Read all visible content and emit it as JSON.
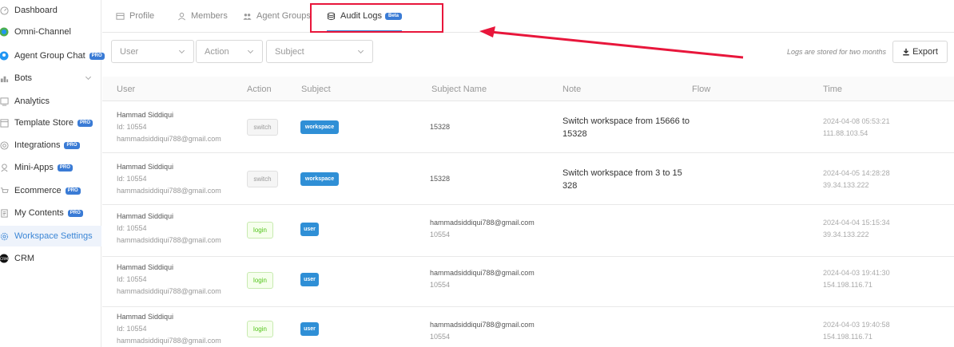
{
  "sidebar": {
    "items": [
      {
        "label": "Dashboard",
        "icon": "dashboard-icon",
        "pro": false
      },
      {
        "label": "Omni-Channel",
        "icon": "omni-channel-icon",
        "pro": false
      },
      {
        "label": "Agent Group Chat",
        "icon": "agent-chat-icon",
        "pro": true
      },
      {
        "label": "Bots",
        "icon": "bots-icon",
        "pro": false,
        "expandable": true
      },
      {
        "label": "Analytics",
        "icon": "analytics-icon",
        "pro": false
      },
      {
        "label": "Template Store",
        "icon": "template-store-icon",
        "pro": true
      },
      {
        "label": "Integrations",
        "icon": "integrations-icon",
        "pro": true
      },
      {
        "label": "Mini-Apps",
        "icon": "mini-apps-icon",
        "pro": true
      },
      {
        "label": "Ecommerce",
        "icon": "ecommerce-icon",
        "pro": true
      },
      {
        "label": "My Contents",
        "icon": "my-contents-icon",
        "pro": true
      },
      {
        "label": "Workspace Settings",
        "icon": "gear-icon",
        "pro": false,
        "active": true
      },
      {
        "label": "CRM",
        "icon": "crm-icon",
        "pro": false
      }
    ],
    "pro_label": "PRO"
  },
  "tabs": [
    {
      "label": "Profile",
      "icon": "profile-icon"
    },
    {
      "label": "Members",
      "icon": "members-icon"
    },
    {
      "label": "Agent Groups",
      "icon": "agent-groups-icon"
    },
    {
      "label": "Audit Logs",
      "icon": "database-icon",
      "active": true,
      "badge": "Beta"
    }
  ],
  "filters": {
    "user": "User",
    "action": "Action",
    "subject": "Subject"
  },
  "retention_note": "Logs are stored for two months",
  "export_label": "Export",
  "columns": [
    "User",
    "Action",
    "Subject",
    "Subject Name",
    "Note",
    "Flow",
    "Time"
  ],
  "rows": [
    {
      "name": "Hammad Siddiqui",
      "id": "Id: 10554",
      "email": "hammadsiddiqui788@gmail.com",
      "action": "switch",
      "subject": "workspace",
      "subject_name_1": "15328",
      "subject_name_2": "",
      "note": "Switch workspace from 15666 to 15328",
      "time": "2024-04-08 05:53:21",
      "ip": "111.88.103.54"
    },
    {
      "name": "Hammad Siddiqui",
      "id": "Id: 10554",
      "email": "hammadsiddiqui788@gmail.com",
      "action": "switch",
      "subject": "workspace",
      "subject_name_1": "15328",
      "subject_name_2": "",
      "note": "Switch workspace from 3 to 15328",
      "time": "2024-04-05 14:28:28",
      "ip": "39.34.133.222"
    },
    {
      "name": "Hammad Siddiqui",
      "id": "Id: 10554",
      "email": "hammadsiddiqui788@gmail.com",
      "action": "login",
      "subject": "user",
      "subject_name_1": "hammadsiddiqui788@gmail.com",
      "subject_name_2": "10554",
      "note": "",
      "time": "2024-04-04 15:15:34",
      "ip": "39.34.133.222"
    },
    {
      "name": "Hammad Siddiqui",
      "id": "Id: 10554",
      "email": "hammadsiddiqui788@gmail.com",
      "action": "login",
      "subject": "user",
      "subject_name_1": "hammadsiddiqui788@gmail.com",
      "subject_name_2": "10554",
      "note": "",
      "time": "2024-04-03 19:41:30",
      "ip": "154.198.116.71"
    },
    {
      "name": "Hammad Siddiqui",
      "id": "Id: 10554",
      "email": "hammadsiddiqui788@gmail.com",
      "action": "login",
      "subject": "user",
      "subject_name_1": "hammadsiddiqui788@gmail.com",
      "subject_name_2": "10554",
      "note": "",
      "time": "2024-04-03 19:40:58",
      "ip": "154.198.116.71"
    }
  ],
  "colors": {
    "accent": "#3b86d6",
    "annotation": "#e8163b",
    "tag_blue": "#2f8fd6",
    "login_green": "#52c41a"
  }
}
